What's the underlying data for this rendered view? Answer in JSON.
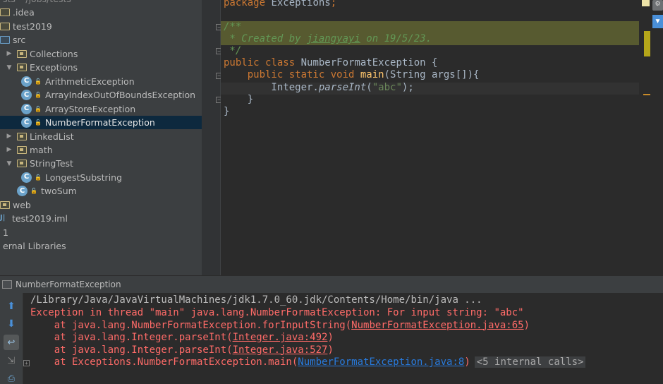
{
  "project_tree": {
    "rows": [
      {
        "label": "sts  ~/jobs/tests",
        "indent": 0,
        "icon": "project-icon"
      },
      {
        "label": ".idea",
        "indent": 0,
        "icon": "folder-icon"
      },
      {
        "label": "test2019",
        "indent": 0,
        "icon": "module-icon"
      },
      {
        "label": "src",
        "indent": 1,
        "icon": "source-folder-icon"
      },
      {
        "label": "Collections",
        "indent": 2,
        "icon": "package-icon"
      },
      {
        "label": "Exceptions",
        "indent": 2,
        "icon": "package-icon"
      },
      {
        "label": "ArithmeticException",
        "indent": 3,
        "icon": "class-icon"
      },
      {
        "label": "ArrayIndexOutOfBoundsException",
        "indent": 3,
        "icon": "class-icon"
      },
      {
        "label": "ArrayStoreException",
        "indent": 3,
        "icon": "class-icon"
      },
      {
        "label": "NumberFormatException",
        "indent": 3,
        "icon": "class-icon"
      },
      {
        "label": "LinkedList",
        "indent": 2,
        "icon": "package-icon"
      },
      {
        "label": "math",
        "indent": 2,
        "icon": "package-icon"
      },
      {
        "label": "StringTest",
        "indent": 2,
        "icon": "package-icon"
      },
      {
        "label": "LongestSubstring",
        "indent": 3,
        "icon": "class-icon"
      },
      {
        "label": "twoSum",
        "indent": 2,
        "icon": "class-icon"
      },
      {
        "label": "web",
        "indent": 1,
        "icon": "web-folder-icon"
      },
      {
        "label": "test2019.iml",
        "indent": 1,
        "icon": "iml-file-icon"
      },
      {
        "label": "1",
        "indent": 0,
        "icon": "file-icon"
      },
      {
        "label": "ernal Libraries",
        "indent": 0,
        "icon": "libraries-icon"
      }
    ]
  },
  "editor": {
    "package_kw": "package",
    "package_name": " Exceptions",
    "semicolon": ";",
    "doc_open": "/**",
    "doc_prefix": " * Created by ",
    "doc_author": "jiangyayi",
    "doc_on": " on ",
    "doc_date": "19/5/23.",
    "doc_close": " */",
    "line_class": {
      "kw1": "public class",
      "name": " NumberFormatException {"
    },
    "line_main": {
      "kw": "    public static void ",
      "fn": "main",
      "rest": "(String args[]){"
    },
    "line_call": {
      "obj": "        Integer.",
      "method": "parseInt",
      "open": "(",
      "arg": "\"abc\"",
      "close": ");"
    },
    "line_close_inner": "    }",
    "line_close_outer": "}"
  },
  "run_panel": {
    "tab_label": "NumberFormatException",
    "cmd": "/Library/Java/JavaVirtualMachines/jdk1.7.0_60.jdk/Contents/Home/bin/java ...",
    "exception": "Exception in thread \"main\" java.lang.NumberFormatException: For input string: \"abc\"",
    "stack": [
      {
        "prefix": "    at java.lang.NumberFormatException.forInputString(",
        "link": "NumberFormatException.java:65",
        "suffix": ")"
      },
      {
        "prefix": "    at java.lang.Integer.parseInt(",
        "link": "Integer.java:492",
        "suffix": ")"
      },
      {
        "prefix": "    at java.lang.Integer.parseInt(",
        "link": "Integer.java:527",
        "suffix": ")"
      },
      {
        "prefix": "    at Exceptions.NumberFormatException.main(",
        "link": "NumberFormatException.java:8",
        "suffix": ")"
      }
    ],
    "internal_calls": "<5 internal calls>"
  },
  "colors": {
    "keyword": "#cc7832",
    "comment": "#629755",
    "string": "#6a8759",
    "method": "#ffc66d",
    "error": "#ff6b68",
    "link": "#287bde",
    "selection": "#0d293e"
  }
}
